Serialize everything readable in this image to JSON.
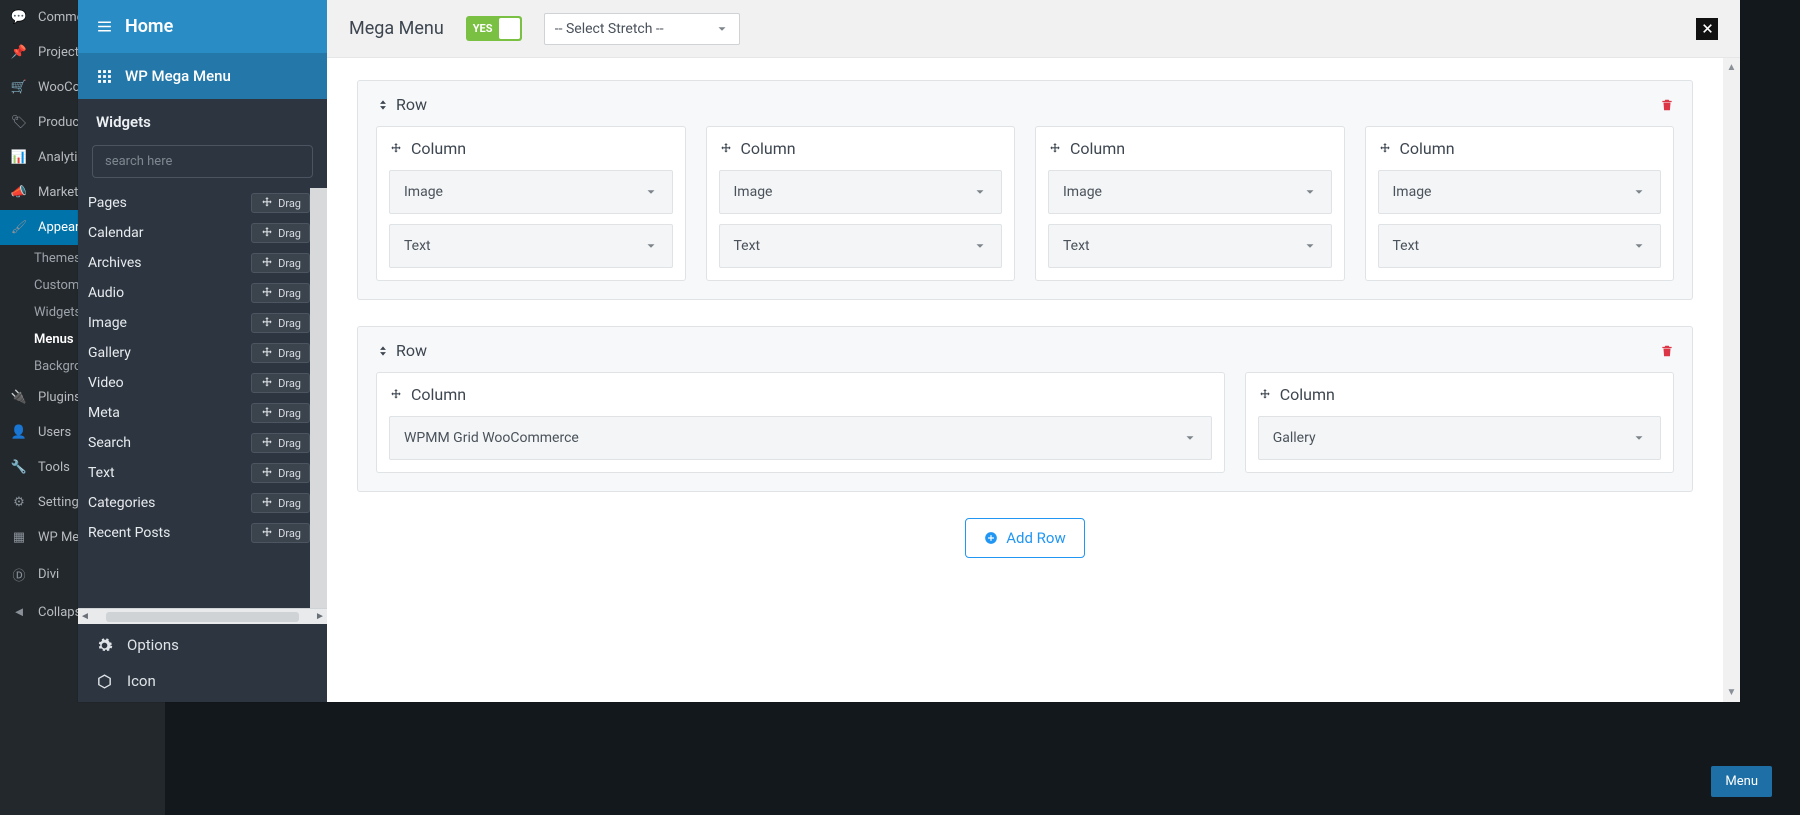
{
  "wp_menu": {
    "items": [
      {
        "icon": "comment",
        "label": "Comments"
      },
      {
        "icon": "pin",
        "label": "Projects"
      },
      {
        "icon": "woo",
        "label": "WooCommerce"
      },
      {
        "icon": "tag",
        "label": "Products"
      },
      {
        "icon": "chart",
        "label": "Analytics"
      },
      {
        "icon": "mega",
        "label": "Marketing"
      },
      {
        "icon": "brush",
        "label": "Appearance",
        "active": true
      }
    ],
    "subs": [
      {
        "label": "Themes"
      },
      {
        "label": "Customize"
      },
      {
        "label": "Widgets"
      },
      {
        "label": "Menus",
        "active": true
      },
      {
        "label": "Background"
      }
    ],
    "items2": [
      {
        "icon": "plug",
        "label": "Plugins"
      },
      {
        "icon": "user",
        "label": "Users"
      },
      {
        "icon": "wrench",
        "label": "Tools"
      },
      {
        "icon": "sliders",
        "label": "Settings"
      },
      {
        "icon": "grid",
        "label": "WP Mega Menu"
      },
      {
        "icon": "divi",
        "label": "Divi"
      },
      {
        "icon": "collapse",
        "label": "Collapse menu"
      }
    ]
  },
  "bg": {
    "menu_btn": "Menu"
  },
  "panel": {
    "home": "Home",
    "mega": "WP Mega Menu",
    "widgets_hdr": "Widgets",
    "search_ph": "search here",
    "drag_label": "Drag",
    "widgets": [
      "Pages",
      "Calendar",
      "Archives",
      "Audio",
      "Image",
      "Gallery",
      "Video",
      "Meta",
      "Search",
      "Text",
      "Categories",
      "Recent Posts"
    ],
    "options": "Options",
    "icon": "Icon"
  },
  "topbar": {
    "title": "Mega Menu",
    "toggle": "YES",
    "stretch": "-- Select Stretch --"
  },
  "builder": {
    "row_label": "Row",
    "col_label": "Column",
    "add_row": "Add Row",
    "rows": [
      {
        "cols": [
          {
            "widgets": [
              "Image",
              "Text"
            ]
          },
          {
            "widgets": [
              "Image",
              "Text"
            ]
          },
          {
            "widgets": [
              "Image",
              "Text"
            ]
          },
          {
            "widgets": [
              "Image",
              "Text"
            ]
          }
        ]
      },
      {
        "cols": [
          {
            "widgets": [
              "WPMM Grid WooCommerce"
            ],
            "grow": true
          },
          {
            "widgets": [
              "Gallery"
            ]
          }
        ]
      }
    ]
  }
}
